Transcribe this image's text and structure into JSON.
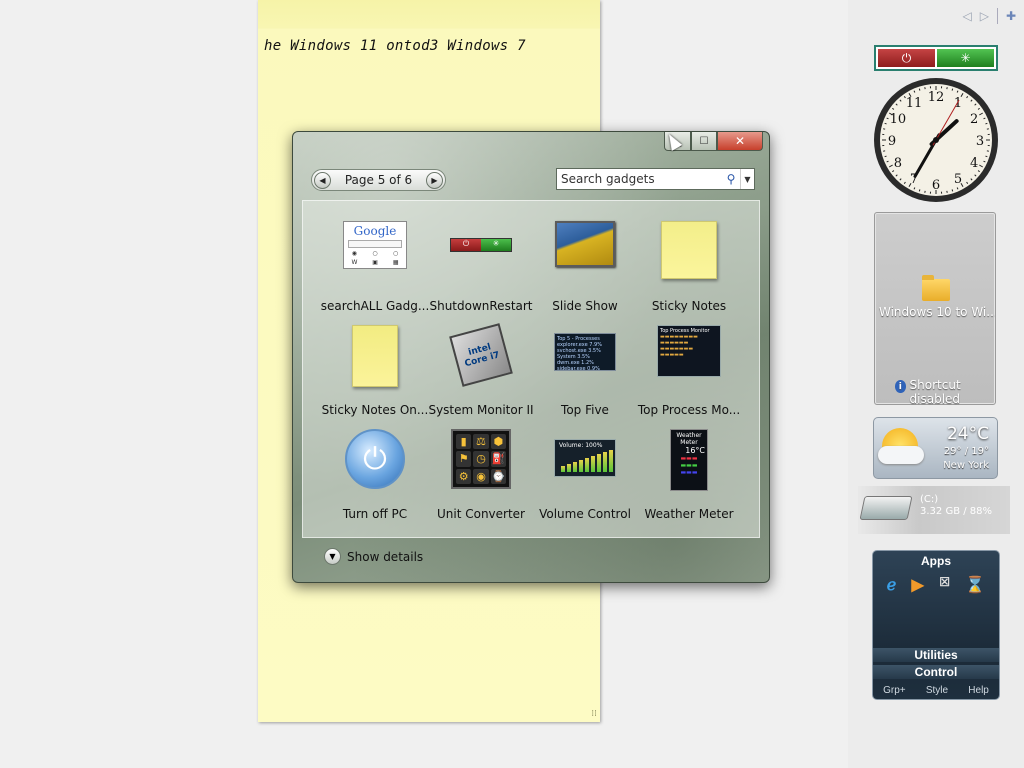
{
  "sticky_note": {
    "text": "he Windows 11 ontod3 Windows 7"
  },
  "gallery": {
    "pager": {
      "label": "Page 5 of 6"
    },
    "search": {
      "placeholder": "Search gadgets"
    },
    "gadgets": [
      {
        "label": "searchALL Gadg...",
        "icon": "google-search-thumb"
      },
      {
        "label": "ShutdownRestart",
        "icon": "shutdown-restart-thumb"
      },
      {
        "label": "Slide Show",
        "icon": "slideshow-thumb"
      },
      {
        "label": "Sticky Notes",
        "icon": "sticky-note-thumb"
      },
      {
        "label": "Sticky Notes On...",
        "icon": "sticky-note-thumb"
      },
      {
        "label": "System Monitor II",
        "icon": "cpu-chip-thumb"
      },
      {
        "label": "Top Five",
        "icon": "top-five-thumb"
      },
      {
        "label": "Top Process Mo...",
        "icon": "top-process-thumb"
      },
      {
        "label": "Turn off PC",
        "icon": "power-button-thumb"
      },
      {
        "label": "Unit Converter",
        "icon": "unit-converter-thumb"
      },
      {
        "label": "Volume Control",
        "icon": "volume-meter-thumb"
      },
      {
        "label": "Weather Meter",
        "icon": "weather-meter-thumb"
      }
    ],
    "thumb_text": {
      "google": "Google",
      "intel": "intel Core i7",
      "top5": "Top 5 - Processes",
      "top5_rows": "explorer.exe 7.9%\nsvchost.exe 3.5%\nSystem 3.5%\ndwm.exe 1.2%\nsidebar.exe 0.9%",
      "topproc": "Top Process Monitor",
      "volume": "Volume: 100%",
      "weather": "Weather Meter",
      "weather_temp": "16°C"
    },
    "details_label": "Show details"
  },
  "sidebar": {
    "folder": {
      "name": "Windows 10 to Wi...",
      "status": "Shortcut disabled"
    },
    "weather": {
      "temp": "24°C",
      "range": "29° / 19°",
      "city": "New York"
    },
    "drive": {
      "label": "(C:)",
      "value": "3.32 GB / 88%"
    },
    "apps": {
      "title": "Apps",
      "section1": "Utilities",
      "section2": "Control",
      "footer": [
        "Grp+",
        "Style",
        "Help"
      ]
    }
  },
  "clock": {
    "hours": 1,
    "minutes": 35,
    "seconds": 5
  },
  "colors": {
    "close_red": "#c7402c",
    "accent_green": "#2a7f6f"
  }
}
